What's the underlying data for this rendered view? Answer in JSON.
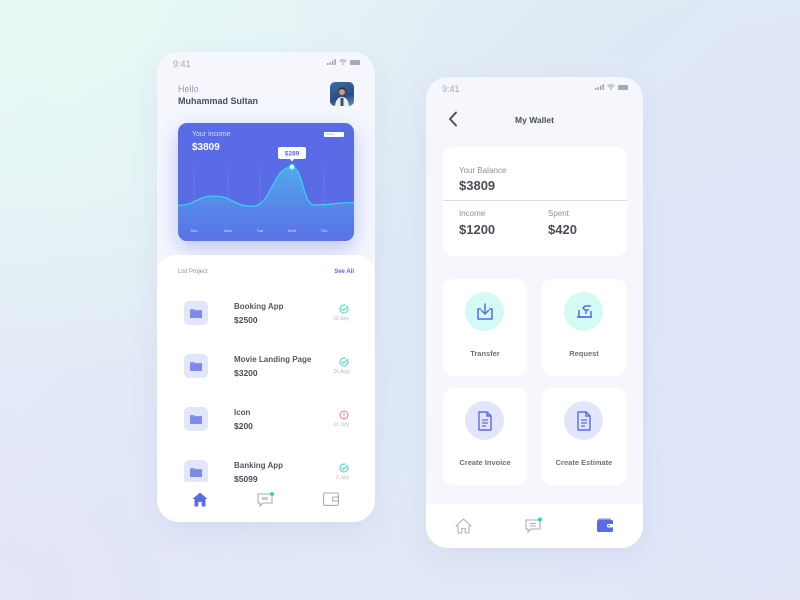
{
  "left_screen": {
    "status": {
      "time": "9:41"
    },
    "greeting": {
      "hello": "Hello",
      "name": "Muhammad Sultan"
    },
    "avatar": {
      "alt": "user-avatar"
    },
    "income_card": {
      "label": "Your income",
      "value": "$3809",
      "period_select": "Week",
      "tooltip": "$289"
    },
    "chart_data": {
      "type": "area",
      "title": "Your income",
      "categories": [
        "Sun",
        "Mon",
        "Tue",
        "Wed",
        "Thu"
      ],
      "series": [
        {
          "name": "Income",
          "values": [
            150,
            175,
            135,
            289,
            140
          ]
        }
      ],
      "highlight": {
        "category": "Wed",
        "value": 289,
        "label": "$289"
      },
      "ylim": [
        0,
        320
      ],
      "grid": "vertical dashed",
      "colors": {
        "background": "#5a6be6",
        "line": "#38d6f2",
        "fill_top": "#4fa3ea",
        "fill_bottom": "#5a78e6"
      }
    },
    "list": {
      "title": "List Project",
      "see_all": "See All",
      "items": [
        {
          "name": "Booking App",
          "amount": "$2500",
          "date": "20 Sep",
          "status": "done"
        },
        {
          "name": "Movie Landing Page",
          "amount": "$3200",
          "date": "26 Aug",
          "status": "done"
        },
        {
          "name": "Icon",
          "amount": "$200",
          "date": "11 July",
          "status": "warning"
        },
        {
          "name": "Banking App",
          "amount": "$5099",
          "date": "2 July",
          "status": "done"
        }
      ]
    },
    "nav": [
      {
        "icon": "home-icon",
        "active": true
      },
      {
        "icon": "chat-icon",
        "badge": true
      },
      {
        "icon": "wallet-icon",
        "active": false
      }
    ]
  },
  "right_screen": {
    "status": {
      "time": "9:41"
    },
    "title": "My Wallet",
    "balance": {
      "label": "Your Balance",
      "value": "$3809",
      "income_label": "Income",
      "income_value": "$1200",
      "spent_label": "Spent",
      "spent_value": "$420"
    },
    "actions": [
      {
        "label": "Transfer",
        "icon": "download-tray-icon"
      },
      {
        "label": "Request",
        "icon": "request-icon"
      },
      {
        "label": "Create Invoice",
        "icon": "document-icon"
      },
      {
        "label": "Create Estimate",
        "icon": "document-icon"
      }
    ],
    "nav": [
      {
        "icon": "home-icon",
        "active": false
      },
      {
        "icon": "chat-icon",
        "badge": true
      },
      {
        "icon": "wallet-icon",
        "active": true
      }
    ]
  },
  "colors": {
    "accent": "#5a6be6",
    "success": "#3fd6c6",
    "warning": "#f07b7b",
    "badge": "#1fd8c8"
  }
}
